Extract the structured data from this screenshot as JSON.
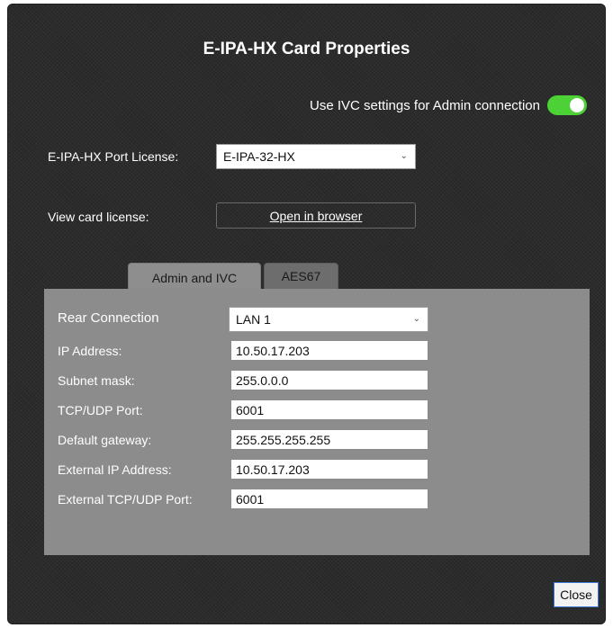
{
  "dialog": {
    "title": "E-IPA-HX Card Properties",
    "ivc_toggle": {
      "label": "Use IVC settings for Admin connection",
      "on": true,
      "color": "#4cd137"
    },
    "port_license": {
      "label": "E-IPA-HX Port License:",
      "value": "E-IPA-32-HX"
    },
    "card_license": {
      "label": "View card license:",
      "button": "Open in browser"
    },
    "tabs": [
      {
        "label": "Admin and IVC",
        "active": true
      },
      {
        "label": "AES67",
        "active": false
      }
    ],
    "fields": {
      "rear_connection": {
        "label": "Rear Connection",
        "value": "LAN 1"
      },
      "ip_address": {
        "label": "IP Address:",
        "value": "10.50.17.203"
      },
      "subnet_mask": {
        "label": "Subnet mask:",
        "value": "255.0.0.0"
      },
      "tcp_udp_port": {
        "label": "TCP/UDP Port:",
        "value": "6001"
      },
      "default_gateway": {
        "label": "Default gateway:",
        "value": "255.255.255.255"
      },
      "external_ip": {
        "label": "External IP Address:",
        "value": "10.50.17.203"
      },
      "external_port": {
        "label": "External TCP/UDP Port:",
        "value": "6001"
      }
    },
    "close_label": "Close"
  }
}
